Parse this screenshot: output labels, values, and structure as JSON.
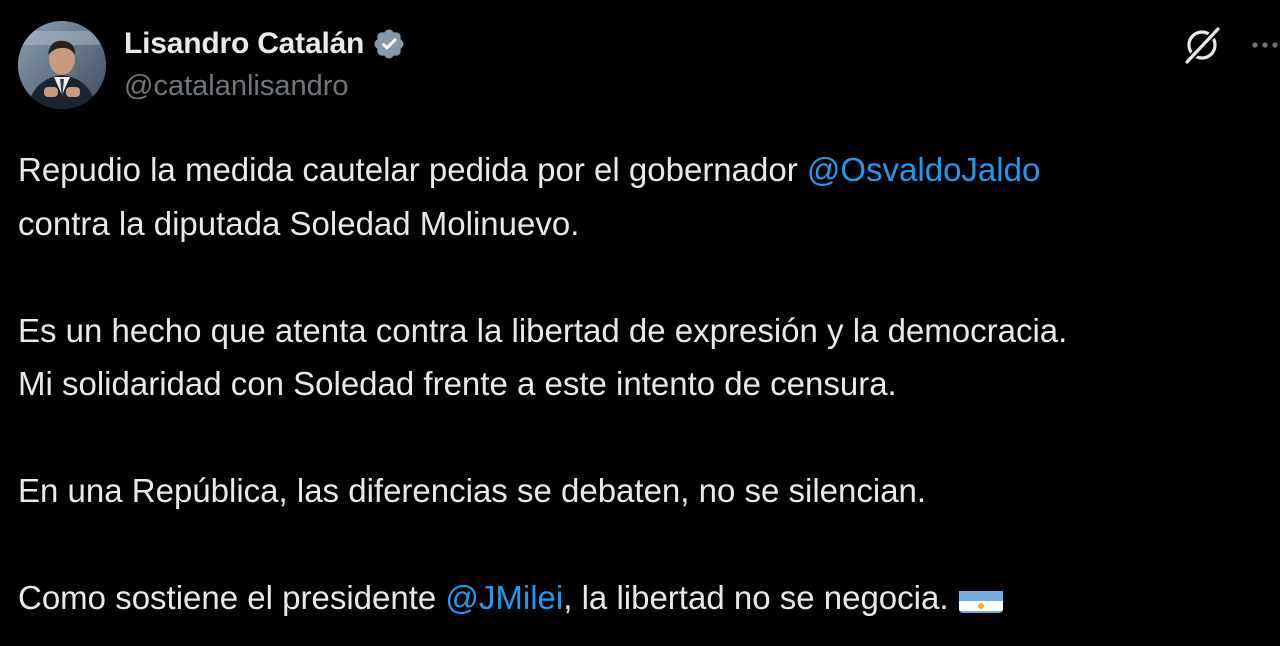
{
  "author": {
    "display_name": "Lisandro Catalán",
    "handle": "@catalanlisandro",
    "verified": true
  },
  "icons": {
    "verified": "verified-badge-icon",
    "grok": "grok-icon",
    "more": "more-options-icon",
    "flag": "argentina-flag-emoji"
  },
  "colors": {
    "background": "#000000",
    "text": "#e7e9ea",
    "secondary_text": "#71767b",
    "mention": "#1d9bf0",
    "verified_badge": "#829aab"
  },
  "post": {
    "p1_l1_before": "Repudio la medida cautelar pedida por el gobernador ",
    "p1_l1_mention": "@OsvaldoJaldo",
    "p1_l2": "contra la diputada Soledad Molinuevo.",
    "p2_l1": "Es un hecho que atenta contra la libertad de expresión y la democracia.",
    "p2_l2": "Mi solidaridad con Soledad frente a este intento de censura.",
    "p3_l1": "En una República, las diferencias se debaten, no se silencian.",
    "p4_before": "Como sostiene el presidente ",
    "p4_mention": "@JMilei",
    "p4_after": ", la libertad no se negocia."
  }
}
